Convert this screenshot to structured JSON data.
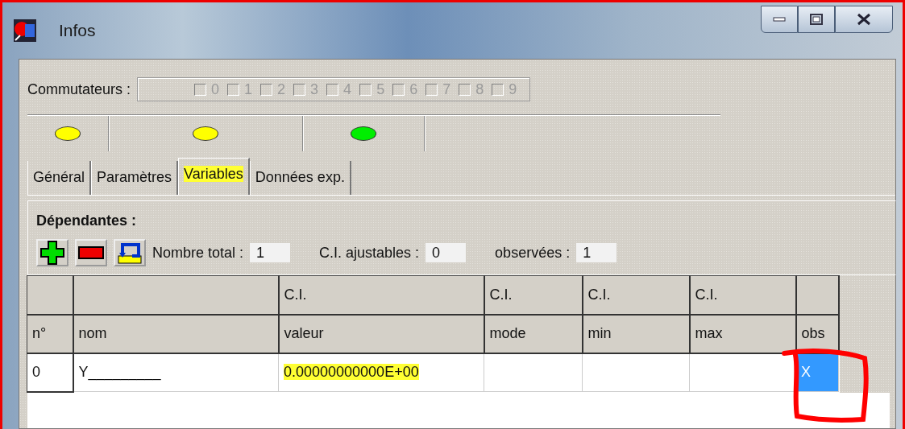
{
  "window": {
    "title": "Infos"
  },
  "switches": {
    "label": "Commutateurs :",
    "disabled": true,
    "items": [
      {
        "label": "0",
        "checked": false
      },
      {
        "label": "1",
        "checked": false
      },
      {
        "label": "2",
        "checked": false
      },
      {
        "label": "3",
        "checked": false
      },
      {
        "label": "4",
        "checked": false
      },
      {
        "label": "5",
        "checked": false
      },
      {
        "label": "6",
        "checked": false
      },
      {
        "label": "7",
        "checked": false
      },
      {
        "label": "8",
        "checked": false
      },
      {
        "label": "9",
        "checked": false
      }
    ]
  },
  "status_lights": [
    {
      "color": "#ffff00"
    },
    {
      "color": "#ffff00"
    },
    {
      "color": "#00ee00"
    }
  ],
  "tabs": [
    {
      "label": "Général",
      "selected": false,
      "highlighted": false
    },
    {
      "label": "Paramètres",
      "selected": false,
      "highlighted": false
    },
    {
      "label": "Variables",
      "selected": true,
      "highlighted": true
    },
    {
      "label": "Données exp.",
      "selected": false,
      "highlighted": false
    }
  ],
  "section": {
    "title": "Dépendantes :",
    "fields": [
      {
        "label": "Nombre total :",
        "value": "1"
      },
      {
        "label": "C.I. ajustables :",
        "value": "0"
      },
      {
        "label": "observées :",
        "value": "1"
      }
    ]
  },
  "table": {
    "header_rows": [
      [
        "",
        "",
        "C.I.",
        "C.I.",
        "C.I.",
        "C.I.",
        ""
      ],
      [
        "n°",
        "nom",
        "valeur",
        "mode",
        "min",
        "max",
        "obs"
      ]
    ],
    "rows": [
      {
        "cells": [
          {
            "text": "0",
            "highlighted": false,
            "selected": false
          },
          {
            "text": "Y_________",
            "highlighted": false,
            "selected": false
          },
          {
            "text": "0.00000000000E+00",
            "highlighted": true,
            "selected": false
          },
          {
            "text": "",
            "highlighted": false,
            "selected": false
          },
          {
            "text": "",
            "highlighted": false,
            "selected": false
          },
          {
            "text": "",
            "highlighted": false,
            "selected": false
          },
          {
            "text": "X",
            "highlighted": false,
            "selected": true
          }
        ]
      }
    ]
  }
}
